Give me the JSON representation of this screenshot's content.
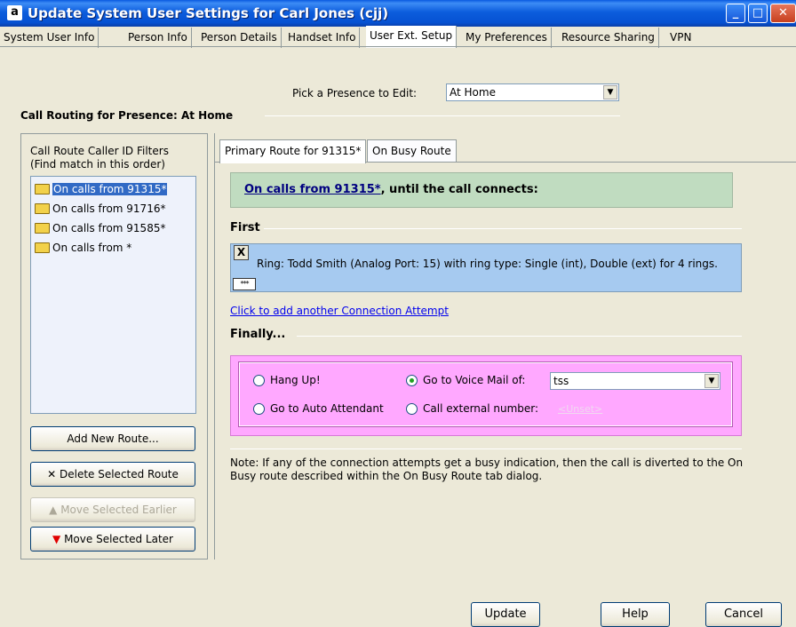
{
  "window": {
    "title": "Update System User Settings for Carl Jones (cjj)",
    "app_icon": "a"
  },
  "tabs": [
    {
      "label": "System User Info"
    },
    {
      "label": "Person Info"
    },
    {
      "label": "Person Details"
    },
    {
      "label": "Handset Info"
    },
    {
      "label": "User Ext. Setup"
    },
    {
      "label": "My Preferences"
    },
    {
      "label": "Resource Sharing"
    },
    {
      "label": "VPN"
    }
  ],
  "active_tab": "User Ext. Setup",
  "presence": {
    "label": "Pick a Presence to Edit:",
    "value": "At Home"
  },
  "section_title": "Call Routing for Presence: At Home",
  "filters": {
    "label_line1": "Call Route Caller ID Filters",
    "label_line2": "(Find match in this order)",
    "items": [
      {
        "label": "On calls from 91315*",
        "selected": true
      },
      {
        "label": "On calls from 91716*"
      },
      {
        "label": "On calls from 91585*"
      },
      {
        "label": "On calls from *"
      }
    ]
  },
  "buttons": {
    "add_route": "Add New Route...",
    "delete_route": "Delete Selected Route",
    "move_earlier": "Move Selected Earlier",
    "move_later": "Move Selected Later"
  },
  "subtabs": [
    {
      "label": "Primary Route for 91315*"
    },
    {
      "label": "On Busy Route"
    }
  ],
  "route": {
    "link_text": "On calls from 91315*",
    "suffix": ", until the call connects:"
  },
  "first_label": "First",
  "ring": {
    "remove_button": "X",
    "options_button": "***",
    "text": "Ring:  Todd Smith (Analog Port: 15) with ring type: Single (int), Double (ext) for 4 rings."
  },
  "add_attempt_link": "Click to add another Connection Attempt",
  "finally_label": "Finally...",
  "finally_options": {
    "hang_up": "Hang Up!",
    "voicemail": "Go to Voice Mail of:",
    "voicemail_value": "tss",
    "auto_attendant": "Go to Auto Attendant",
    "external": "Call external number:",
    "external_value": "<Unset>",
    "selected": "voicemail"
  },
  "note": "Note: If any of the connection attempts get a busy indication, then the call is diverted to the On Busy route described within the On Busy Route tab dialog.",
  "footer": {
    "update": "Update",
    "help": "Help",
    "cancel": "Cancel"
  },
  "colors": {
    "titlebar": "#0a5ae0",
    "route_header_bg": "#c0dcc0",
    "ring_bg": "#a6caf0",
    "finally_bg": "#ffa8ff",
    "selection": "#316ac5"
  }
}
